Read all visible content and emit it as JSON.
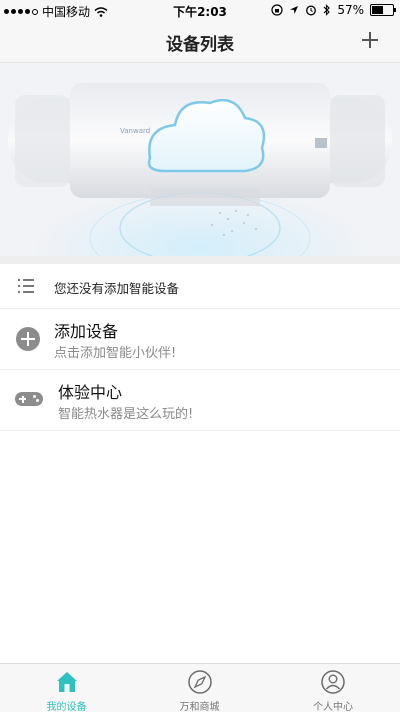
{
  "status_bar": {
    "carrier": "中国移动",
    "time": "下午2:03",
    "battery": "57%",
    "battery_level": 0.57
  },
  "nav": {
    "title": "设备列表"
  },
  "notice": {
    "text": "您还没有添加智能设备"
  },
  "rows": [
    {
      "title": "添加设备",
      "subtitle": "点击添加智能小伙伴!"
    },
    {
      "title": "体验中心",
      "subtitle": "智能热水器是这么玩的!"
    }
  ],
  "tabs": [
    {
      "label": "我的设备",
      "icon": "home-icon",
      "active": true
    },
    {
      "label": "万和商城",
      "icon": "compass-icon",
      "active": false
    },
    {
      "label": "个人中心",
      "icon": "user-icon",
      "active": false
    }
  ],
  "colors": {
    "accent": "#2fc1c1",
    "icon_gray": "#8c8c8c"
  }
}
